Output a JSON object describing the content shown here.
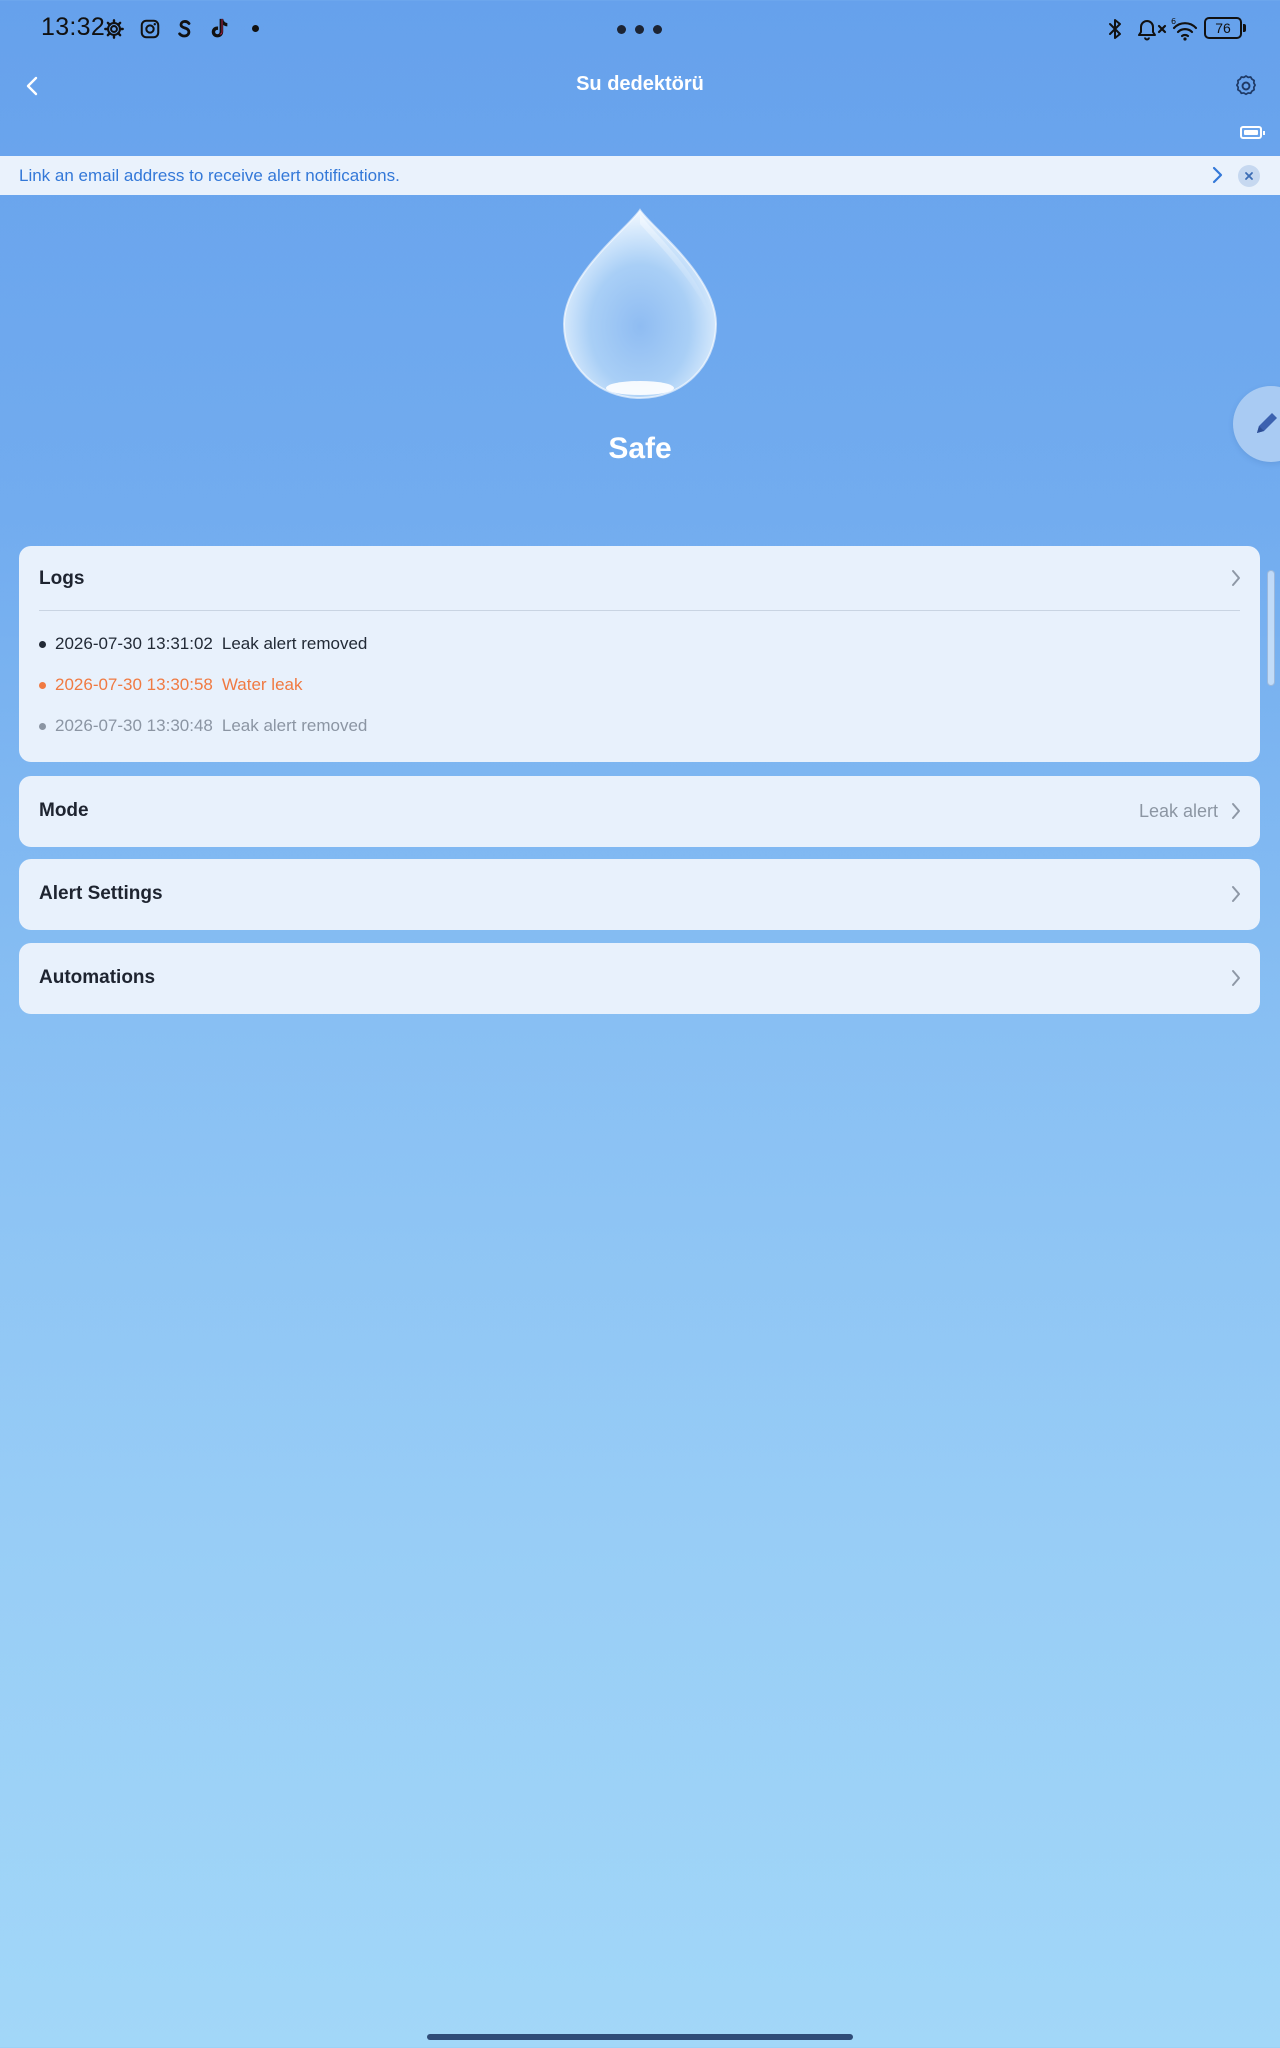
{
  "status_bar": {
    "time": "13:32",
    "notification_icons": [
      "gear-icon",
      "instagram-icon",
      "shazam-icon",
      "tiktok-icon"
    ],
    "battery_level": "76"
  },
  "header": {
    "title": "Su dedektörü"
  },
  "banner": {
    "text": "Link an email address to receive alert notifications."
  },
  "device": {
    "status": "Safe"
  },
  "logs": {
    "title": "Logs",
    "entries": [
      {
        "time": "2026-07-30 13:31:02",
        "message": "Leak alert removed",
        "color": "#222a36"
      },
      {
        "time": "2026-07-30 13:30:58",
        "message": "Water leak",
        "color": "#f07a42"
      },
      {
        "time": "2026-07-30 13:30:48",
        "message": "Leak alert removed",
        "color": "#8b95a3"
      }
    ]
  },
  "mode": {
    "label": "Mode",
    "value": "Leak alert"
  },
  "alert_settings": {
    "label": "Alert Settings"
  },
  "automations": {
    "label": "Automations"
  },
  "colors": {
    "accent": "#3378d8",
    "warning": "#f07a42",
    "card_bg": "#e8f1fc"
  }
}
